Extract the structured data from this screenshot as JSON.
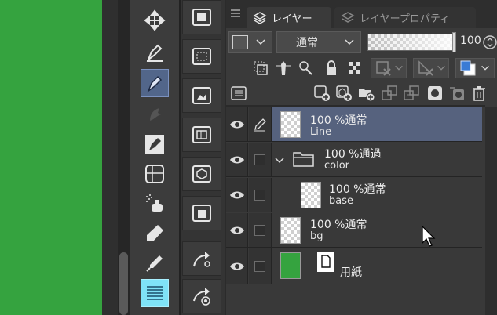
{
  "canvas": {
    "color": "#35a33f"
  },
  "tools": [
    {
      "name": "move-tool",
      "icon": "move-arrows-icon"
    },
    {
      "name": "pen-tool",
      "icon": "pen-nib-icon"
    },
    {
      "name": "pen-tool-active",
      "icon": "pen-nib-icon",
      "active": true
    },
    {
      "name": "airbrush-tool",
      "icon": "bird-icon"
    },
    {
      "name": "decoration-tool",
      "icon": "pen-nib-icon"
    },
    {
      "name": "figure-tool",
      "icon": "ruler-grid-icon"
    },
    {
      "name": "spray-tool",
      "icon": "spray-icon"
    },
    {
      "name": "fill-tool",
      "icon": "bottle-icon"
    },
    {
      "name": "eyedropper-tool",
      "icon": "eyedropper-icon"
    },
    {
      "name": "text-tool",
      "icon": "lines-icon",
      "highlight": true
    }
  ],
  "subtools": [
    {
      "name": "image-layer-sub",
      "icon": "image-folder-icon"
    },
    {
      "name": "vector-sub",
      "icon": "dashed-frame-icon"
    },
    {
      "name": "raster-sub",
      "icon": "image-folder-icon"
    },
    {
      "name": "frame-sub",
      "icon": "frame-folder-icon"
    },
    {
      "name": "3d-sub",
      "icon": "cube-folder-icon"
    },
    {
      "name": "building-sub",
      "icon": "building-folder-icon"
    },
    {
      "name": "arrow-sub",
      "icon": "arrow-link-icon"
    },
    {
      "name": "target-sub",
      "icon": "arrow-target-icon"
    }
  ],
  "panel": {
    "menu_icon": "hamburger-icon",
    "tab_layer": "レイヤー",
    "tab_props": "レイヤープロパティ",
    "blend_mode": "通常",
    "opacity": "100",
    "accent_blue": "#3a7bd5"
  },
  "layers": [
    {
      "id": "line",
      "mode": "100 %通常",
      "name": "Line",
      "selected": true,
      "type": "raster"
    },
    {
      "id": "color",
      "mode": "100 %通過",
      "name": "color",
      "type": "folder"
    },
    {
      "id": "base",
      "mode": "100 %通常",
      "name": "base",
      "type": "raster-child"
    },
    {
      "id": "bg",
      "mode": "100 %通常",
      "name": "bg",
      "type": "raster"
    },
    {
      "id": "paper",
      "name": "用紙",
      "type": "paper",
      "color": "#35a33f"
    }
  ]
}
